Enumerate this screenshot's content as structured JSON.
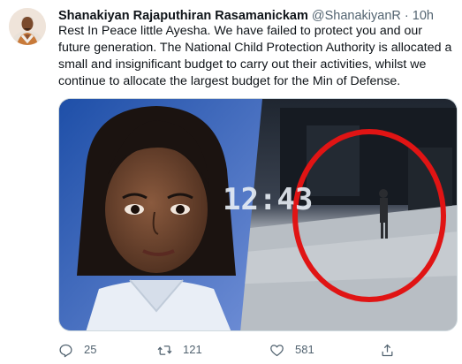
{
  "tweet": {
    "author_name": "Shanakiyan Rajaputhiran Rasamanickam",
    "handle": "@ShanakiyanR",
    "separator": "·",
    "time": "10h",
    "text": "Rest In Peace little Ayesha. We have failed to protect you and our future generation. The National Child Protection Authority is allocated a small and insignificant budget to carry out their activities, whilst we continue to allocate the largest budget for the Min of Defense.",
    "media": {
      "cctv_timestamp": "12:43"
    },
    "actions": {
      "reply_count": "25",
      "retweet_count": "121",
      "like_count": "581"
    }
  },
  "colors": {
    "text_primary": "#0f1419",
    "text_secondary": "#536471",
    "circle_highlight": "#e01414"
  },
  "icons": [
    "reply-icon",
    "retweet-icon",
    "like-icon",
    "share-icon"
  ]
}
